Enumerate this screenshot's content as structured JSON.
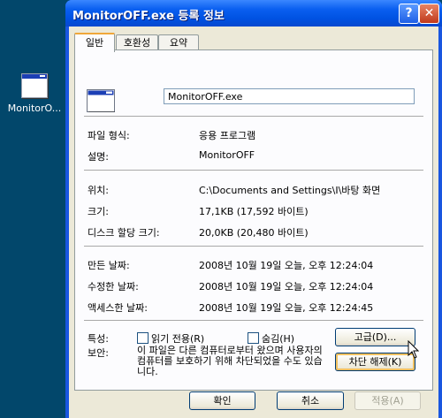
{
  "desktop": {
    "icon_label": "MonitorO..."
  },
  "window": {
    "title": "MonitorOFF.exe 등록 정보",
    "help_label": "?",
    "close_label": "✕",
    "tabs": [
      "일반",
      "호환성",
      "요약"
    ],
    "filename": "MonitorOFF.exe",
    "fields": {
      "file_type_label": "파일 형식:",
      "file_type_value": "응용 프로그램",
      "description_label": "설명:",
      "description_value": "MonitorOFF",
      "location_label": "위치:",
      "location_value": "C:\\Documents and Settings\\I\\바탕 화면",
      "size_label": "크기:",
      "size_value": "17,1KB (17,592 바이트)",
      "disk_size_label": "디스크 할당 크기:",
      "disk_size_value": "20,0KB (20,480 바이트)",
      "created_label": "만든 날짜:",
      "created_value": "2008년 10월 19일 오늘, 오후 12:24:04",
      "modified_label": "수정한 날짜:",
      "modified_value": "2008년 10월 19일 오늘, 오후 12:24:04",
      "accessed_label": "액세스한 날짜:",
      "accessed_value": "2008년 10월 19일 오늘, 오후 12:24:45"
    },
    "attributes": {
      "label": "특성:",
      "readonly_label": "읽기 전용(R)",
      "readonly_checked": false,
      "hidden_label": "숨김(H)",
      "hidden_checked": false,
      "advanced_button": "고급(D)..."
    },
    "security": {
      "label": "보안:",
      "text": "이 파일은 다른 컴퓨터로부터 왔으며 사용자의 컴퓨터를 보호하기 위해 차단되었을 수도 있습니다.",
      "unblock_button": "차단 해제(K)"
    },
    "buttons": {
      "ok": "확인",
      "cancel": "취소",
      "apply": "적용(A)"
    }
  }
}
